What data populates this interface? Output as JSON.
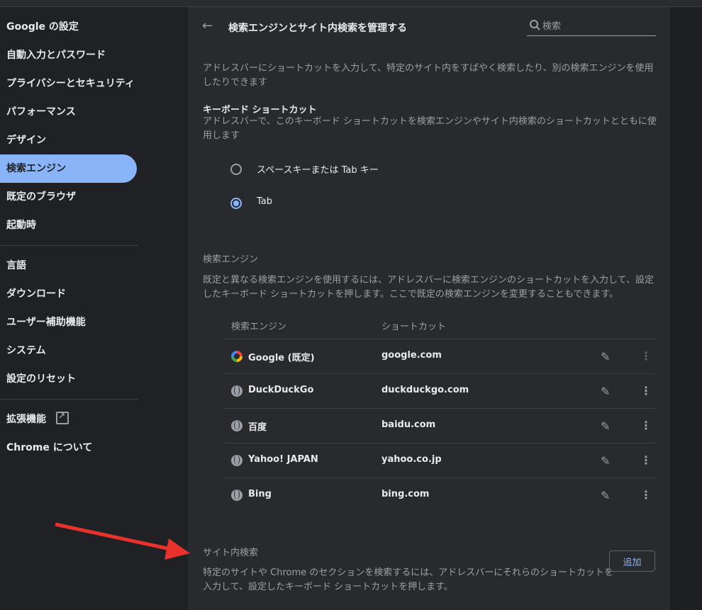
{
  "sidebar": {
    "items": [
      {
        "label": "Google の設定"
      },
      {
        "label": "自動入力とパスワード"
      },
      {
        "label": "プライバシーとセキュリティ"
      },
      {
        "label": "パフォーマンス"
      },
      {
        "label": "デザイン"
      },
      {
        "label": "検索エンジン"
      },
      {
        "label": "既定のブラウザ"
      },
      {
        "label": "起動時"
      }
    ],
    "advanced": [
      {
        "label": "言語"
      },
      {
        "label": "ダウンロード"
      },
      {
        "label": "ユーザー補助機能"
      },
      {
        "label": "システム"
      },
      {
        "label": "設定のリセット"
      }
    ],
    "extensions_label": "拡張機能",
    "about_label": "Chrome について"
  },
  "header": {
    "title": "検索エンジンとサイト内検索を管理する",
    "search_placeholder": "検索"
  },
  "intro": {
    "line1": "アドレスバーにショートカットを入力して、特定のサイト内をすばやく検索したり、別の検索エンジンを使用",
    "line2": "したりできます"
  },
  "keyboard": {
    "heading": "キーボード ショートカット",
    "desc1": "アドレスバーで、このキーボード ショートカットを検索エンジンやサイト内検索のショートカットとともに使",
    "desc2": "用します",
    "options": [
      {
        "label": "スペースキーまたは Tab キー",
        "checked": false
      },
      {
        "label": "Tab",
        "checked": true
      }
    ]
  },
  "engines": {
    "section_label": "検索エンジン",
    "desc1": "既定と異なる検索エンジンを使用するには、アドレスバーに検索エンジンのショートカットを入力して、設定",
    "desc2": "したキーボード ショートカットを押します。ここで既定の検索エンジンを変更することもできます。",
    "col_engine": "検索エンジン",
    "col_shortcut": "ショートカット",
    "rows": [
      {
        "name": "Google (既定)",
        "shortcut": "google.com",
        "icon": "google-logo"
      },
      {
        "name": "DuckDuckGo",
        "shortcut": "duckduckgo.com",
        "icon": "globe-icon"
      },
      {
        "name": "百度",
        "shortcut": "baidu.com",
        "icon": "globe-icon"
      },
      {
        "name": "Yahoo! JAPAN",
        "shortcut": "yahoo.co.jp",
        "icon": "globe-icon"
      },
      {
        "name": "Bing",
        "shortcut": "bing.com",
        "icon": "globe-icon"
      }
    ]
  },
  "site_search": {
    "section_label": "サイト内検索",
    "desc1": "特定のサイトや Chrome のセクションを検索するには、アドレスバーにそれらのショートカットを",
    "desc2": "入力して、設定したキーボード ショートカットを押します。",
    "add_label": "追加"
  },
  "colors": {
    "accent": "#8ab4f8",
    "background": "#202124",
    "card": "#292a2d",
    "annotation_arrow": "#e8322b"
  }
}
